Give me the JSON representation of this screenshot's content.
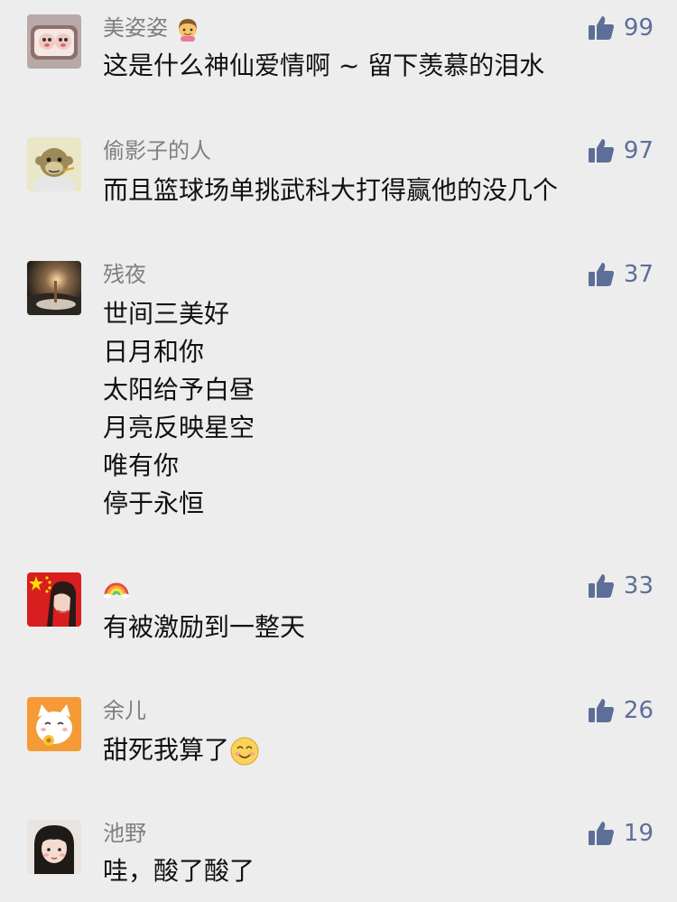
{
  "comments": [
    {
      "user": "美姿姿",
      "user_emoji": "girl-emoji",
      "likes": "99",
      "lines": [
        "这是什么神仙爱情啊 ~ 留下羡慕的泪水"
      ]
    },
    {
      "user": "偷影子的人",
      "likes": "97",
      "lines": [
        "而且篮球场单挑武科大打得赢他的没几个"
      ]
    },
    {
      "user": "残夜",
      "likes": "37",
      "lines": [
        "世间三美好",
        "日月和你",
        "太阳给予白昼",
        "月亮反映星空",
        "唯有你",
        "停于永恒"
      ]
    },
    {
      "user": "",
      "user_emoji": "rainbow-emoji",
      "likes": "33",
      "lines": [
        "有被激励到一整天"
      ]
    },
    {
      "user": "余儿",
      "likes": "26",
      "lines": [
        "甜死我算了"
      ],
      "trailing_emoji": "smiling-face-emoji"
    },
    {
      "user": "池野",
      "likes": "19",
      "lines": [
        "哇，酸了酸了"
      ]
    }
  ],
  "icons": {
    "like": "thumbs-up-icon"
  },
  "colors": {
    "background": "#ededed",
    "username": "#7f7f7f",
    "like": "#5d6f98",
    "text": "#111111"
  }
}
